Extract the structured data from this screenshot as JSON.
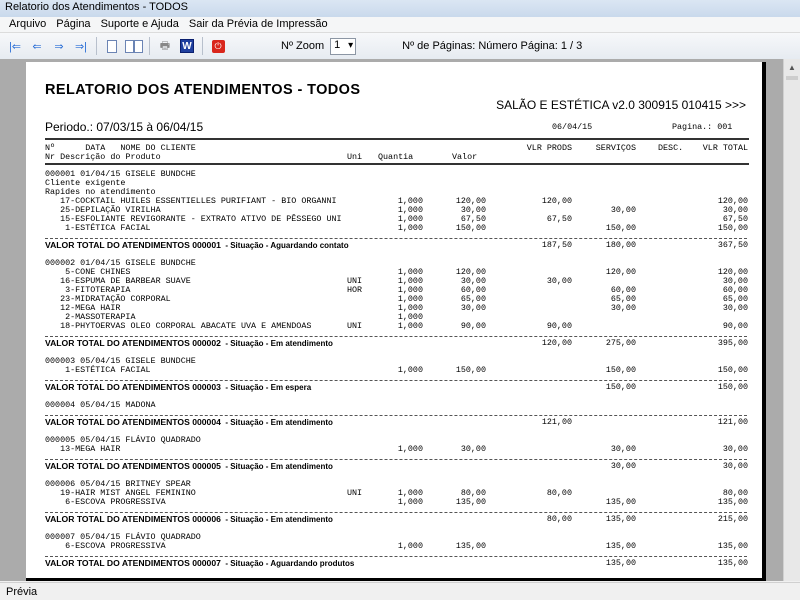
{
  "window": {
    "title": "Relatorio dos Atendimentos - TODOS"
  },
  "menu": [
    "Arquivo",
    "Página",
    "Suporte e Ajuda",
    "Sair da Prévia de Impressão"
  ],
  "toolbar": {
    "zoom_label": "Nº Zoom",
    "zoom_value": "1",
    "page_info": "Nº de Páginas: Número Página: 1 / 3"
  },
  "report": {
    "title": "RELATORIO DOS ATENDIMENTOS - TODOS",
    "system": "SALÃO E ESTÉTICA v2.0 300915 010415 >>>",
    "period": "Periodo.: 07/03/15 à 06/04/15",
    "date": "06/04/15",
    "page": "Pagina.: 001",
    "headers": {
      "row1": "Nº      DATA   NOME DO CLIENTE",
      "row2": "Nr Descrição do Produto",
      "uni": "Uni",
      "qty": "Quantia",
      "valor": "Valor",
      "prods": "VLR PRODS",
      "serv": "SERVIÇOS",
      "desc": "DESC.",
      "total": "VLR TOTAL"
    },
    "blocks": [
      {
        "header": "000001 01/04/15 GISELE BUNDCHE",
        "notes": [
          "Cliente exigente",
          "Rapides no atendimento"
        ],
        "items": [
          {
            "desc": "   17-COCKTAIL HUILES ESSENTIELLES PURIFIANT - BIO ORGANNI",
            "uni": "",
            "qty": "1,000",
            "valor": "120,00",
            "prods": "120,00",
            "serv": "",
            "total": "120,00"
          },
          {
            "desc": "   25-DEPILAÇÃO VIRILHA",
            "uni": "",
            "qty": "1,000",
            "valor": "30,00",
            "prods": "",
            "serv": "30,00",
            "total": "30,00"
          },
          {
            "desc": "   15-ESFOLIANTE REVIGORANTE - EXTRATO ATIVO DE PÊSSEGO UNI",
            "uni": "",
            "qty": "1,000",
            "valor": "67,50",
            "prods": "67,50",
            "serv": "",
            "total": "67,50"
          },
          {
            "desc": "    1-ESTÉTICA FACIAL",
            "uni": "",
            "qty": "1,000",
            "valor": "150,00",
            "prods": "",
            "serv": "150,00",
            "total": "150,00"
          }
        ],
        "total": {
          "label": "VALOR TOTAL DO ATENDIMENTOS 000001",
          "situacao": "  - Situação - Aguardando contato",
          "prods": "187,50",
          "serv": "180,00",
          "total": "367,50"
        }
      },
      {
        "header": "000002 01/04/15 GISELE BUNDCHE",
        "notes": [],
        "items": [
          {
            "desc": "    5-CONE CHINES",
            "uni": "",
            "qty": "1,000",
            "valor": "120,00",
            "prods": "",
            "serv": "120,00",
            "total": "120,00"
          },
          {
            "desc": "   16-ESPUMA DE BARBEAR SUAVE",
            "uni": "UNI",
            "qty": "1,000",
            "valor": "30,00",
            "prods": "30,00",
            "serv": "",
            "total": "30,00"
          },
          {
            "desc": "    3-FITOTERAPIA",
            "uni": "HOR",
            "qty": "1,000",
            "valor": "60,00",
            "prods": "",
            "serv": "60,00",
            "total": "60,00"
          },
          {
            "desc": "   23-MIDRATAÇÃO CORPORAL",
            "uni": "",
            "qty": "1,000",
            "valor": "65,00",
            "prods": "",
            "serv": "65,00",
            "total": "65,00"
          },
          {
            "desc": "   12-MEGA HAIR",
            "uni": "",
            "qty": "1,000",
            "valor": "30,00",
            "prods": "",
            "serv": "30,00",
            "total": "30,00"
          },
          {
            "desc": "    2-MASSOTERAPIA",
            "uni": "",
            "qty": "1,000",
            "valor": "",
            "prods": "",
            "serv": "",
            "total": ""
          },
          {
            "desc": "   18-PHYTOERVAS OLEO CORPORAL ABACATE UVA E AMENDOAS",
            "uni": "UNI",
            "qty": "1,000",
            "valor": "90,00",
            "prods": "90,00",
            "serv": "",
            "total": "90,00"
          }
        ],
        "total": {
          "label": "VALOR TOTAL DO ATENDIMENTOS 000002",
          "situacao": "  - Situação - Em atendimento",
          "prods": "120,00",
          "serv": "275,00",
          "total": "395,00"
        }
      },
      {
        "header": "000003 05/04/15 GISELE BUNDCHE",
        "notes": [],
        "items": [
          {
            "desc": "    1-ESTÉTICA FACIAL",
            "uni": "",
            "qty": "1,000",
            "valor": "150,00",
            "prods": "",
            "serv": "150,00",
            "total": "150,00"
          }
        ],
        "total": {
          "label": "VALOR TOTAL DO ATENDIMENTOS 000003",
          "situacao": "  - Situação - Em espera",
          "prods": "",
          "serv": "150,00",
          "total": "150,00"
        }
      },
      {
        "header": "000004 05/04/15 MADONA",
        "notes": [],
        "items": [],
        "total": {
          "label": "VALOR TOTAL DO ATENDIMENTOS 000004",
          "situacao": "  - Situação - Em atendimento",
          "prods": "121,00",
          "serv": "",
          "total": "121,00"
        }
      },
      {
        "header": "000005 05/04/15 FLÁVIO QUADRADO",
        "notes": [],
        "items": [
          {
            "desc": "   13-MEGA HAIR",
            "uni": "",
            "qty": "1,000",
            "valor": "30,00",
            "prods": "",
            "serv": "30,00",
            "total": "30,00"
          }
        ],
        "total": {
          "label": "VALOR TOTAL DO ATENDIMENTOS 000005",
          "situacao": "  - Situação - Em atendimento",
          "prods": "",
          "serv": "30,00",
          "total": "30,00"
        }
      },
      {
        "header": "000006 05/04/15 BRITNEY SPEAR",
        "notes": [],
        "items": [
          {
            "desc": "   19-HAIR MIST ANGEL FEMININO",
            "uni": "UNI",
            "qty": "1,000",
            "valor": "80,00",
            "prods": "80,00",
            "serv": "",
            "total": "80,00"
          },
          {
            "desc": "    6-ESCOVA PROGRESSIVA",
            "uni": "",
            "qty": "1,000",
            "valor": "135,00",
            "prods": "",
            "serv": "135,00",
            "total": "135,00"
          }
        ],
        "total": {
          "label": "VALOR TOTAL DO ATENDIMENTOS 000006",
          "situacao": "  - Situação - Em atendimento",
          "prods": "80,00",
          "serv": "135,00",
          "total": "215,00"
        }
      },
      {
        "header": "000007 05/04/15 FLÁVIO QUADRADO",
        "notes": [],
        "items": [
          {
            "desc": "    6-ESCOVA PROGRESSIVA",
            "uni": "",
            "qty": "1,000",
            "valor": "135,00",
            "prods": "",
            "serv": "135,00",
            "total": "135,00"
          }
        ],
        "total": {
          "label": "VALOR TOTAL DO ATENDIMENTOS 000007",
          "situacao": "  - Situação - Aguardando produtos",
          "prods": "",
          "serv": "135,00",
          "total": "135,00"
        }
      }
    ]
  },
  "status": {
    "text": "Prévia"
  }
}
